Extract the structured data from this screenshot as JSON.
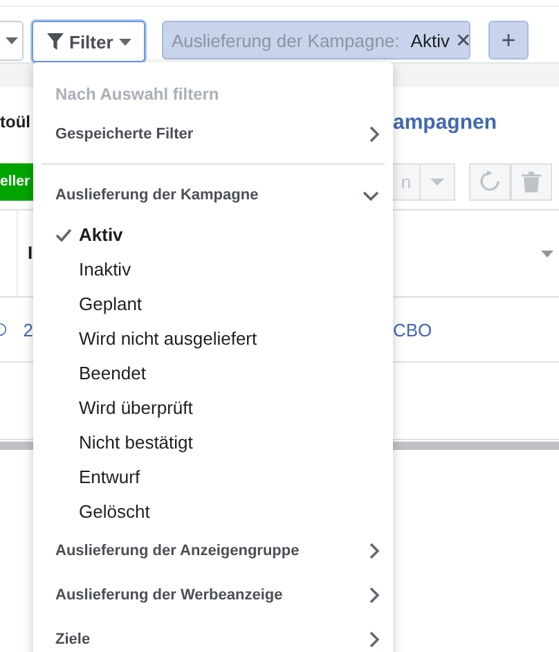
{
  "filter_bar": {
    "filter_button": {
      "label": "Filter",
      "focused": true
    },
    "chip": {
      "field": "Auslieferung der Kampagne:",
      "value": "Aktiv",
      "remove": "✕"
    },
    "add_button": "+"
  },
  "background": {
    "title_left": "toül",
    "title_right": "ampagnen",
    "create_button": "eller",
    "toolbar_button": "n",
    "table": {
      "header": "I",
      "row": {
        "cell_1": "2",
        "cell_2": "CBO"
      }
    }
  },
  "menu": [
    {
      "kind": "disabled",
      "label": "Nach Auswahl filtern"
    },
    {
      "kind": "submenu",
      "label": "Gespeicherte Filter"
    },
    {
      "kind": "divider"
    },
    {
      "kind": "section",
      "label": "Auslieferung der Kampagne",
      "expanded": true,
      "options": [
        {
          "label": "Aktiv",
          "selected": true
        },
        {
          "label": "Inaktiv",
          "selected": false
        },
        {
          "label": "Geplant",
          "selected": false
        },
        {
          "label": "Wird nicht ausgeliefert",
          "selected": false
        },
        {
          "label": "Beendet",
          "selected": false
        },
        {
          "label": "Wird überprüft",
          "selected": false
        },
        {
          "label": "Nicht bestätigt",
          "selected": false
        },
        {
          "label": "Entwurf",
          "selected": false
        },
        {
          "label": "Gelöscht",
          "selected": false
        }
      ]
    },
    {
      "kind": "submenu",
      "label": "Auslieferung der Anzeigengruppe"
    },
    {
      "kind": "submenu",
      "label": "Auslieferung der Werbeanzeige"
    },
    {
      "kind": "submenu",
      "label": "Ziele"
    }
  ]
}
